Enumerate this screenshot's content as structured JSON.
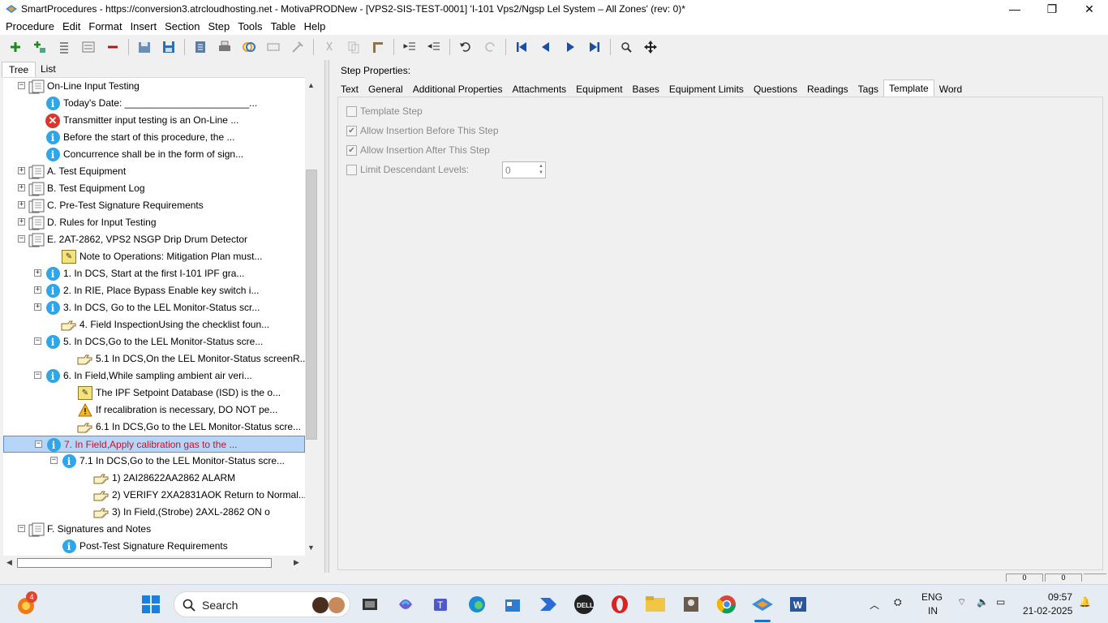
{
  "window": {
    "title": "SmartProcedures - https://conversion3.atrcloudhosting.net - MotivaPRODNew - [VPS2-SIS-TEST-0001] 'I-101 Vps2/Ngsp Lel System – All Zones' (rev: 0)*",
    "controls": {
      "minimize": "—",
      "restore": "❐",
      "close": "✕"
    }
  },
  "menu": [
    "Procedure",
    "Edit",
    "Format",
    "Insert",
    "Section",
    "Step",
    "Tools",
    "Table",
    "Help"
  ],
  "toolbar_icons": [
    "add-icon",
    "add-child-icon",
    "outline-icon",
    "outline-alt-icon",
    "remove-icon",
    "open-icon",
    "save-icon",
    "export-icon",
    "print-icon",
    "link-icon",
    "field-icon",
    "tag-icon",
    "cut-icon",
    "copy-icon",
    "paste-icon",
    "indent-icon",
    "outdent-icon",
    "undo-icon",
    "redo-icon",
    "first-icon",
    "previous-icon",
    "next-icon",
    "last-icon",
    "search-icon",
    "move-icon"
  ],
  "left_tabs": {
    "tree": "Tree",
    "list": "List"
  },
  "tree": [
    {
      "depth": 0,
      "expander": "−",
      "icon": "doc",
      "label": "On-Line Input Testing"
    },
    {
      "depth": 1,
      "expander": "",
      "icon": "info",
      "label": "Today's Date: _______________________..."
    },
    {
      "depth": 1,
      "expander": "",
      "icon": "error",
      "label": "Transmitter input testing is an On-Line ..."
    },
    {
      "depth": 1,
      "expander": "",
      "icon": "info",
      "label": "Before the start of this procedure, the ..."
    },
    {
      "depth": 1,
      "expander": "",
      "icon": "info",
      "label": "Concurrence shall be in the form of sign..."
    },
    {
      "depth": 0,
      "expander": "+",
      "icon": "doc",
      "label": "A. Test Equipment"
    },
    {
      "depth": 0,
      "expander": "+",
      "icon": "doc",
      "label": "B. Test Equipment Log"
    },
    {
      "depth": 0,
      "expander": "+",
      "icon": "doc",
      "label": "C. Pre-Test Signature Requirements"
    },
    {
      "depth": 0,
      "expander": "+",
      "icon": "doc",
      "label": "D. Rules for Input Testing"
    },
    {
      "depth": 0,
      "expander": "−",
      "icon": "doc",
      "label": "E. 2AT-2862, VPS2 NSGP Drip Drum Detector"
    },
    {
      "depth": 2,
      "expander": "",
      "icon": "note",
      "label": "Note to Operations: Mitigation Plan must..."
    },
    {
      "depth": 1,
      "expander": "+",
      "icon": "info",
      "label": "1. In DCS, Start at the first I-101 IPF gra..."
    },
    {
      "depth": 1,
      "expander": "+",
      "icon": "info",
      "label": "2. In RIE, Place Bypass Enable key switch i..."
    },
    {
      "depth": 1,
      "expander": "+",
      "icon": "info",
      "label": "3. In DCS, Go to the LEL Monitor-Status scr..."
    },
    {
      "depth": 2,
      "expander": "",
      "icon": "hand",
      "label": "4. Field InspectionUsing the checklist foun..."
    },
    {
      "depth": 1,
      "expander": "−",
      "icon": "info",
      "label": "5. In DCS,Go to the LEL Monitor-Status scre..."
    },
    {
      "depth": 3,
      "expander": "",
      "icon": "hand",
      "label": "5.1 In DCS,On the LEL Monitor-Status screenR..."
    },
    {
      "depth": 1,
      "expander": "−",
      "icon": "info",
      "label": "6. In Field,While sampling ambient air veri..."
    },
    {
      "depth": 3,
      "expander": "",
      "icon": "note",
      "label": "The IPF Setpoint Database (ISD) is the o..."
    },
    {
      "depth": 3,
      "expander": "",
      "icon": "warn",
      "label": "If recalibration is necessary, DO NOT pe..."
    },
    {
      "depth": 3,
      "expander": "",
      "icon": "hand",
      "label": "6.1 In DCS,Go to the LEL Monitor-Status scre..."
    },
    {
      "depth": 1,
      "expander": "−",
      "icon": "info",
      "label": "7. In Field,Apply calibration gas to the ...",
      "selected": true
    },
    {
      "depth": 2,
      "expander": "−",
      "icon": "info",
      "label": "7.1 In DCS,Go to the LEL Monitor-Status scre..."
    },
    {
      "depth": 4,
      "expander": "",
      "icon": "hand",
      "label": "1) 2AI28622AA2862 ALARM"
    },
    {
      "depth": 4,
      "expander": "",
      "icon": "hand",
      "label": "2) VERIFY 2XA2831AOK Return to Normal..."
    },
    {
      "depth": 4,
      "expander": "",
      "icon": "hand",
      "label": "3) In Field,(Strobe) 2AXL-2862 ON o"
    },
    {
      "depth": 0,
      "expander": "−",
      "icon": "doc",
      "label": "F. Signatures and Notes"
    },
    {
      "depth": 2,
      "expander": "",
      "icon": "info",
      "label": "Post-Test Signature Requirements"
    }
  ],
  "step_properties": {
    "title": "Step Properties:",
    "tabs": [
      "Text",
      "General",
      "Additional Properties",
      "Attachments",
      "Equipment",
      "Bases",
      "Equipment Limits",
      "Questions",
      "Readings",
      "Tags",
      "Template",
      "Word"
    ],
    "active_tab": "Template",
    "template": {
      "template_step": {
        "label": "Template Step",
        "checked": false
      },
      "allow_before": {
        "label": "Allow Insertion Before This Step",
        "checked": true
      },
      "allow_after": {
        "label": "Allow Insertion After This Step",
        "checked": true
      },
      "limit_levels": {
        "label": "Limit Descendant Levels:",
        "checked": false,
        "value": "0"
      }
    }
  },
  "status": {
    "box1": "0",
    "box2": "0"
  },
  "taskbar": {
    "search": "Search",
    "notification_count": "4",
    "language": "ENG",
    "region": "IN",
    "time": "09:57",
    "date": "21-02-2025"
  }
}
